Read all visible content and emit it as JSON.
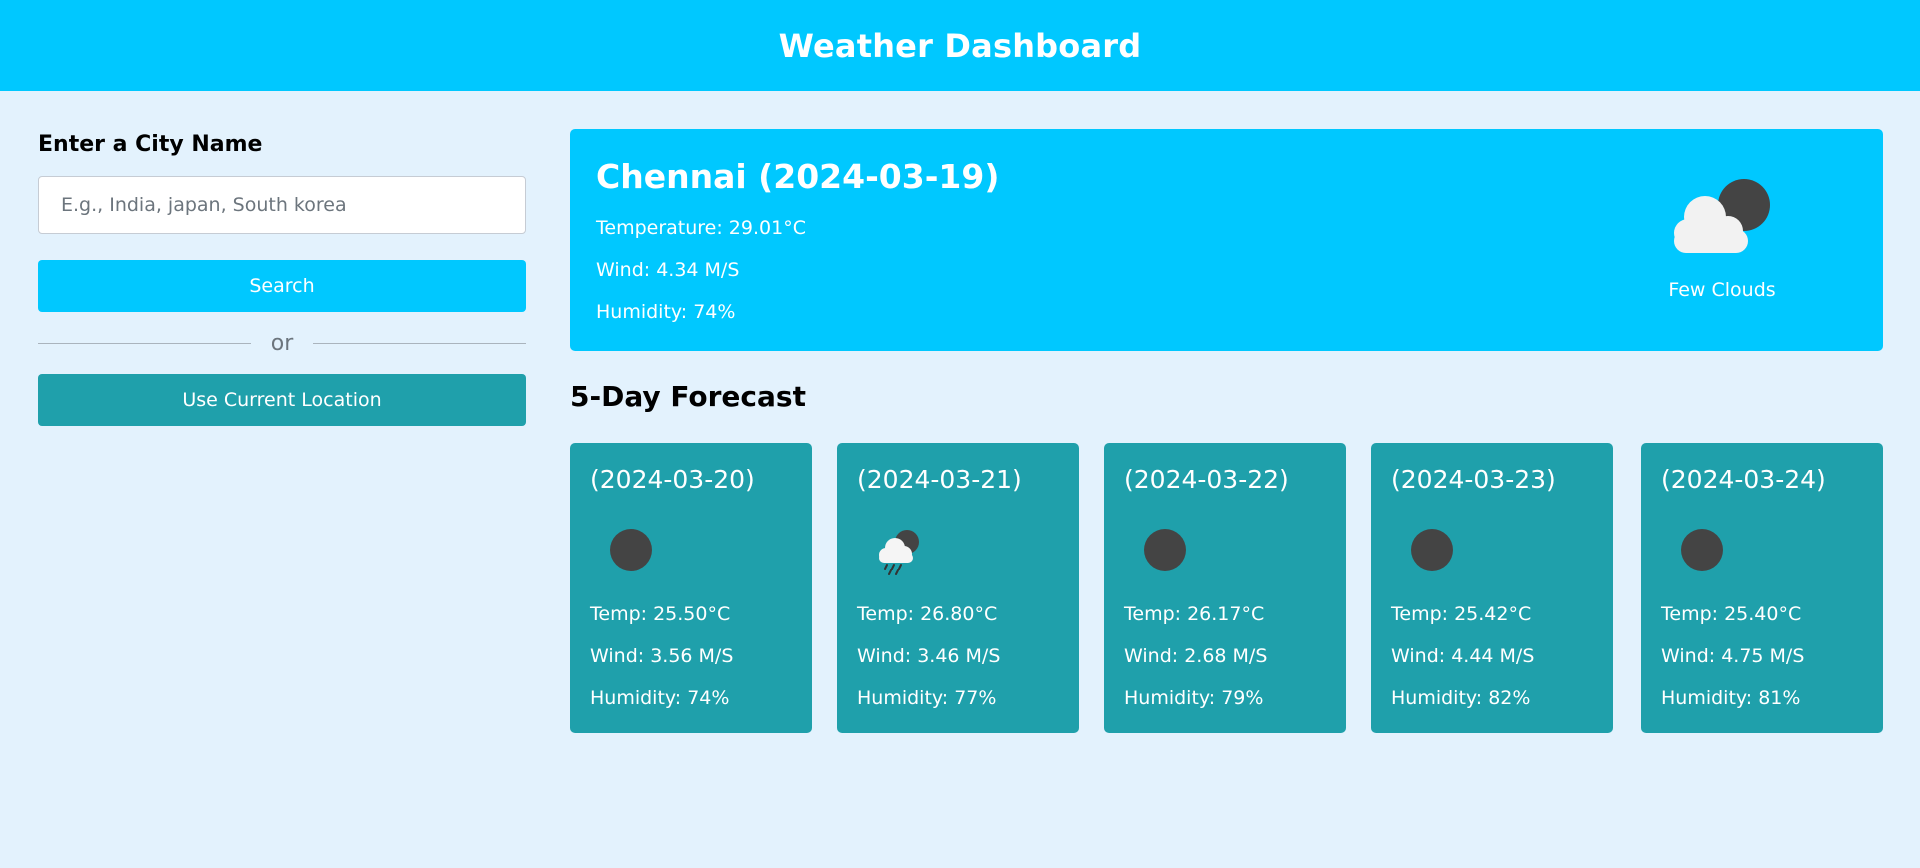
{
  "header": {
    "title": "Weather Dashboard"
  },
  "search": {
    "label": "Enter a City Name",
    "placeholder": "E.g., India, japan, South korea",
    "value": "",
    "search_button": "Search",
    "divider_text": "or",
    "location_button": "Use Current Location"
  },
  "current": {
    "title": "Chennai (2024-03-19)",
    "temperature": "Temperature: 29.01°C",
    "wind": "Wind: 4.34 M/S",
    "humidity": "Humidity: 74%",
    "condition": "Few Clouds",
    "icon": "few-clouds-night-icon"
  },
  "forecast": {
    "title": "5-Day Forecast",
    "days": [
      {
        "date": "(2024-03-20)",
        "icon": "clear-night-icon",
        "temp": "Temp: 25.50°C",
        "wind": "Wind: 3.56 M/S",
        "humidity": "Humidity: 74%"
      },
      {
        "date": "(2024-03-21)",
        "icon": "rain-night-icon",
        "temp": "Temp: 26.80°C",
        "wind": "Wind: 3.46 M/S",
        "humidity": "Humidity: 77%"
      },
      {
        "date": "(2024-03-22)",
        "icon": "clear-night-icon",
        "temp": "Temp: 26.17°C",
        "wind": "Wind: 2.68 M/S",
        "humidity": "Humidity: 79%"
      },
      {
        "date": "(2024-03-23)",
        "icon": "clear-night-icon",
        "temp": "Temp: 25.42°C",
        "wind": "Wind: 4.44 M/S",
        "humidity": "Humidity: 82%"
      },
      {
        "date": "(2024-03-24)",
        "icon": "clear-night-icon",
        "temp": "Temp: 25.40°C",
        "wind": "Wind: 4.75 M/S",
        "humidity": "Humidity: 81%"
      }
    ]
  },
  "colors": {
    "header_bg": "#00c8ff",
    "page_bg": "#e3f2fd",
    "current_card_bg": "#00c8ff",
    "forecast_card_bg": "#1fa0ab",
    "moon": "#444444",
    "cloud": "#f2f2f2"
  }
}
